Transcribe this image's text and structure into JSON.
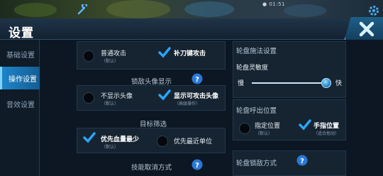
{
  "status_bar": {
    "text": "● 01:51"
  },
  "title": "设置",
  "sidebar": {
    "items": [
      {
        "label": "基础设置",
        "active": false
      },
      {
        "label": "操作设置",
        "active": true
      },
      {
        "label": "音效设置",
        "active": false
      }
    ]
  },
  "attack": {
    "normal_label": "普通攻击",
    "normal_sub": "（默认）",
    "normal_checked": false,
    "last_hit_label": "补刀键攻击",
    "last_hit_checked": true
  },
  "lock_avatar": {
    "heading": "锁敌头像显示",
    "hide_label": "不显示头像",
    "hide_sub": "（默认）",
    "hide_checked": false,
    "show_label": "显示可攻击头像",
    "show_sub": "（高级操作）",
    "show_checked": true
  },
  "target_filter": {
    "heading": "目标筛选",
    "lowhp_label": "优先血量最少",
    "lowhp_sub": "（默认）",
    "lowhp_checked": true,
    "nearest_label": "优先最近单位",
    "nearest_checked": false
  },
  "skill_cancel": {
    "heading": "技能取消方式"
  },
  "wheel_cast": {
    "heading": "轮盘施法设置",
    "sensitivity_label": "轮盘灵敏度",
    "slow_label": "慢",
    "fast_label": "快",
    "sensitivity_value": 0.95
  },
  "wheel_callout": {
    "heading": "轮盘呼出位置",
    "fixed_label": "指定位置",
    "fixed_sub": "（默认）",
    "fixed_checked": false,
    "finger_label": "手指位置",
    "finger_sub": "（适合拖动）",
    "finger_checked": true
  },
  "wheel_lock": {
    "heading": "轮盘锁敌方式"
  },
  "colors": {
    "accent": "#1e84c9",
    "check": "#2aa6ff",
    "help": "#2a78d6"
  }
}
